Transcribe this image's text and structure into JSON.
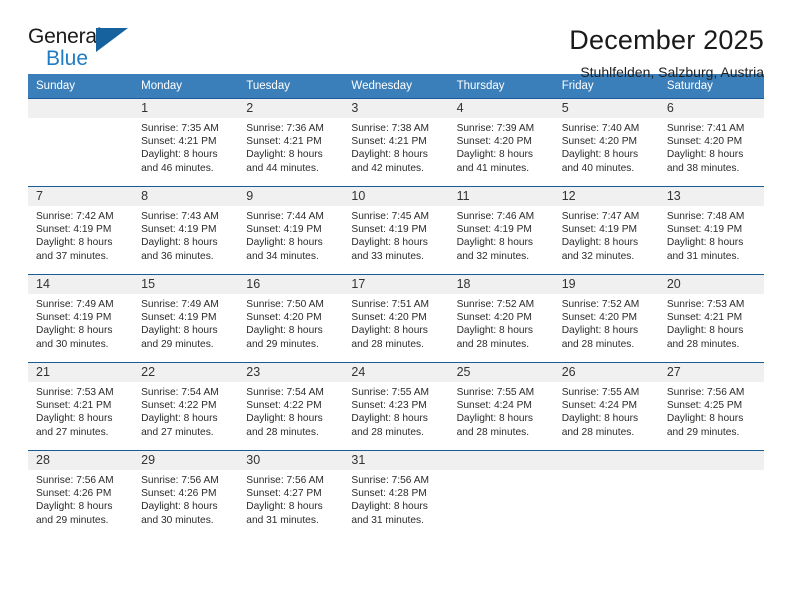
{
  "brand": {
    "name_top": "General",
    "name_bottom": "Blue",
    "accent_color": "#1f7cc4",
    "triangle_color": "#16629f"
  },
  "header": {
    "title": "December 2025",
    "subtitle": "Stuhlfelden, Salzburg, Austria"
  },
  "calendar": {
    "header_bg": "#3b7fba",
    "row_rule_color": "#1a5a96",
    "daynum_bg": "#f0f0f0",
    "weekday_headers": [
      "Sunday",
      "Monday",
      "Tuesday",
      "Wednesday",
      "Thursday",
      "Friday",
      "Saturday"
    ],
    "weeks": [
      [
        {
          "day": "",
          "sunrise": "",
          "sunset": "",
          "daylight_1": "",
          "daylight_2": ""
        },
        {
          "day": "1",
          "sunrise": "Sunrise: 7:35 AM",
          "sunset": "Sunset: 4:21 PM",
          "daylight_1": "Daylight: 8 hours",
          "daylight_2": "and 46 minutes."
        },
        {
          "day": "2",
          "sunrise": "Sunrise: 7:36 AM",
          "sunset": "Sunset: 4:21 PM",
          "daylight_1": "Daylight: 8 hours",
          "daylight_2": "and 44 minutes."
        },
        {
          "day": "3",
          "sunrise": "Sunrise: 7:38 AM",
          "sunset": "Sunset: 4:21 PM",
          "daylight_1": "Daylight: 8 hours",
          "daylight_2": "and 42 minutes."
        },
        {
          "day": "4",
          "sunrise": "Sunrise: 7:39 AM",
          "sunset": "Sunset: 4:20 PM",
          "daylight_1": "Daylight: 8 hours",
          "daylight_2": "and 41 minutes."
        },
        {
          "day": "5",
          "sunrise": "Sunrise: 7:40 AM",
          "sunset": "Sunset: 4:20 PM",
          "daylight_1": "Daylight: 8 hours",
          "daylight_2": "and 40 minutes."
        },
        {
          "day": "6",
          "sunrise": "Sunrise: 7:41 AM",
          "sunset": "Sunset: 4:20 PM",
          "daylight_1": "Daylight: 8 hours",
          "daylight_2": "and 38 minutes."
        }
      ],
      [
        {
          "day": "7",
          "sunrise": "Sunrise: 7:42 AM",
          "sunset": "Sunset: 4:19 PM",
          "daylight_1": "Daylight: 8 hours",
          "daylight_2": "and 37 minutes."
        },
        {
          "day": "8",
          "sunrise": "Sunrise: 7:43 AM",
          "sunset": "Sunset: 4:19 PM",
          "daylight_1": "Daylight: 8 hours",
          "daylight_2": "and 36 minutes."
        },
        {
          "day": "9",
          "sunrise": "Sunrise: 7:44 AM",
          "sunset": "Sunset: 4:19 PM",
          "daylight_1": "Daylight: 8 hours",
          "daylight_2": "and 34 minutes."
        },
        {
          "day": "10",
          "sunrise": "Sunrise: 7:45 AM",
          "sunset": "Sunset: 4:19 PM",
          "daylight_1": "Daylight: 8 hours",
          "daylight_2": "and 33 minutes."
        },
        {
          "day": "11",
          "sunrise": "Sunrise: 7:46 AM",
          "sunset": "Sunset: 4:19 PM",
          "daylight_1": "Daylight: 8 hours",
          "daylight_2": "and 32 minutes."
        },
        {
          "day": "12",
          "sunrise": "Sunrise: 7:47 AM",
          "sunset": "Sunset: 4:19 PM",
          "daylight_1": "Daylight: 8 hours",
          "daylight_2": "and 32 minutes."
        },
        {
          "day": "13",
          "sunrise": "Sunrise: 7:48 AM",
          "sunset": "Sunset: 4:19 PM",
          "daylight_1": "Daylight: 8 hours",
          "daylight_2": "and 31 minutes."
        }
      ],
      [
        {
          "day": "14",
          "sunrise": "Sunrise: 7:49 AM",
          "sunset": "Sunset: 4:19 PM",
          "daylight_1": "Daylight: 8 hours",
          "daylight_2": "and 30 minutes."
        },
        {
          "day": "15",
          "sunrise": "Sunrise: 7:49 AM",
          "sunset": "Sunset: 4:19 PM",
          "daylight_1": "Daylight: 8 hours",
          "daylight_2": "and 29 minutes."
        },
        {
          "day": "16",
          "sunrise": "Sunrise: 7:50 AM",
          "sunset": "Sunset: 4:20 PM",
          "daylight_1": "Daylight: 8 hours",
          "daylight_2": "and 29 minutes."
        },
        {
          "day": "17",
          "sunrise": "Sunrise: 7:51 AM",
          "sunset": "Sunset: 4:20 PM",
          "daylight_1": "Daylight: 8 hours",
          "daylight_2": "and 28 minutes."
        },
        {
          "day": "18",
          "sunrise": "Sunrise: 7:52 AM",
          "sunset": "Sunset: 4:20 PM",
          "daylight_1": "Daylight: 8 hours",
          "daylight_2": "and 28 minutes."
        },
        {
          "day": "19",
          "sunrise": "Sunrise: 7:52 AM",
          "sunset": "Sunset: 4:20 PM",
          "daylight_1": "Daylight: 8 hours",
          "daylight_2": "and 28 minutes."
        },
        {
          "day": "20",
          "sunrise": "Sunrise: 7:53 AM",
          "sunset": "Sunset: 4:21 PM",
          "daylight_1": "Daylight: 8 hours",
          "daylight_2": "and 28 minutes."
        }
      ],
      [
        {
          "day": "21",
          "sunrise": "Sunrise: 7:53 AM",
          "sunset": "Sunset: 4:21 PM",
          "daylight_1": "Daylight: 8 hours",
          "daylight_2": "and 27 minutes."
        },
        {
          "day": "22",
          "sunrise": "Sunrise: 7:54 AM",
          "sunset": "Sunset: 4:22 PM",
          "daylight_1": "Daylight: 8 hours",
          "daylight_2": "and 27 minutes."
        },
        {
          "day": "23",
          "sunrise": "Sunrise: 7:54 AM",
          "sunset": "Sunset: 4:22 PM",
          "daylight_1": "Daylight: 8 hours",
          "daylight_2": "and 28 minutes."
        },
        {
          "day": "24",
          "sunrise": "Sunrise: 7:55 AM",
          "sunset": "Sunset: 4:23 PM",
          "daylight_1": "Daylight: 8 hours",
          "daylight_2": "and 28 minutes."
        },
        {
          "day": "25",
          "sunrise": "Sunrise: 7:55 AM",
          "sunset": "Sunset: 4:24 PM",
          "daylight_1": "Daylight: 8 hours",
          "daylight_2": "and 28 minutes."
        },
        {
          "day": "26",
          "sunrise": "Sunrise: 7:55 AM",
          "sunset": "Sunset: 4:24 PM",
          "daylight_1": "Daylight: 8 hours",
          "daylight_2": "and 28 minutes."
        },
        {
          "day": "27",
          "sunrise": "Sunrise: 7:56 AM",
          "sunset": "Sunset: 4:25 PM",
          "daylight_1": "Daylight: 8 hours",
          "daylight_2": "and 29 minutes."
        }
      ],
      [
        {
          "day": "28",
          "sunrise": "Sunrise: 7:56 AM",
          "sunset": "Sunset: 4:26 PM",
          "daylight_1": "Daylight: 8 hours",
          "daylight_2": "and 29 minutes."
        },
        {
          "day": "29",
          "sunrise": "Sunrise: 7:56 AM",
          "sunset": "Sunset: 4:26 PM",
          "daylight_1": "Daylight: 8 hours",
          "daylight_2": "and 30 minutes."
        },
        {
          "day": "30",
          "sunrise": "Sunrise: 7:56 AM",
          "sunset": "Sunset: 4:27 PM",
          "daylight_1": "Daylight: 8 hours",
          "daylight_2": "and 31 minutes."
        },
        {
          "day": "31",
          "sunrise": "Sunrise: 7:56 AM",
          "sunset": "Sunset: 4:28 PM",
          "daylight_1": "Daylight: 8 hours",
          "daylight_2": "and 31 minutes."
        },
        {
          "day": "",
          "sunrise": "",
          "sunset": "",
          "daylight_1": "",
          "daylight_2": ""
        },
        {
          "day": "",
          "sunrise": "",
          "sunset": "",
          "daylight_1": "",
          "daylight_2": ""
        },
        {
          "day": "",
          "sunrise": "",
          "sunset": "",
          "daylight_1": "",
          "daylight_2": ""
        }
      ]
    ]
  }
}
